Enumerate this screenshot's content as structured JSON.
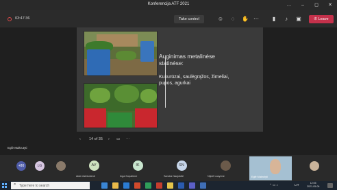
{
  "window": {
    "title": "Konferencija ATF 2021",
    "controls": [
      "…",
      "–",
      "◻",
      "✕"
    ]
  },
  "toolbar": {
    "timer": "03:47:36",
    "take_control": "Take control",
    "leave": "Leave",
    "icons": [
      "people-icon",
      "chat-icon",
      "reactions-icon",
      "more-icon",
      "camera-icon",
      "mic-icon",
      "share-icon"
    ]
  },
  "slide": {
    "heading": "Auginimas metalinėse statinėse:",
    "body": "Kukurūzai, saulėgrąžos, žirneliai, pupos, agurkai",
    "counter": "14 of 35"
  },
  "presenter": "Eglė Makrutyti",
  "participants": {
    "overflow": "+80",
    "tiles": [
      {
        "initials": "LG",
        "name": ""
      },
      {
        "initials": "AV",
        "name": "Aida Vaičiunienė"
      },
      {
        "initials": "IK",
        "name": "Inga Kopaliene"
      },
      {
        "initials": "SN",
        "name": "Sandra Naujokitė"
      },
      {
        "initials": "",
        "name": "Nijolė Lasyene"
      },
      {
        "initials": "",
        "name": "Eglė Makrutyti"
      }
    ]
  },
  "taskbar": {
    "search_placeholder": "Type here to search",
    "lang": "LIT",
    "time": "12:05",
    "date": "2021-05-06"
  }
}
